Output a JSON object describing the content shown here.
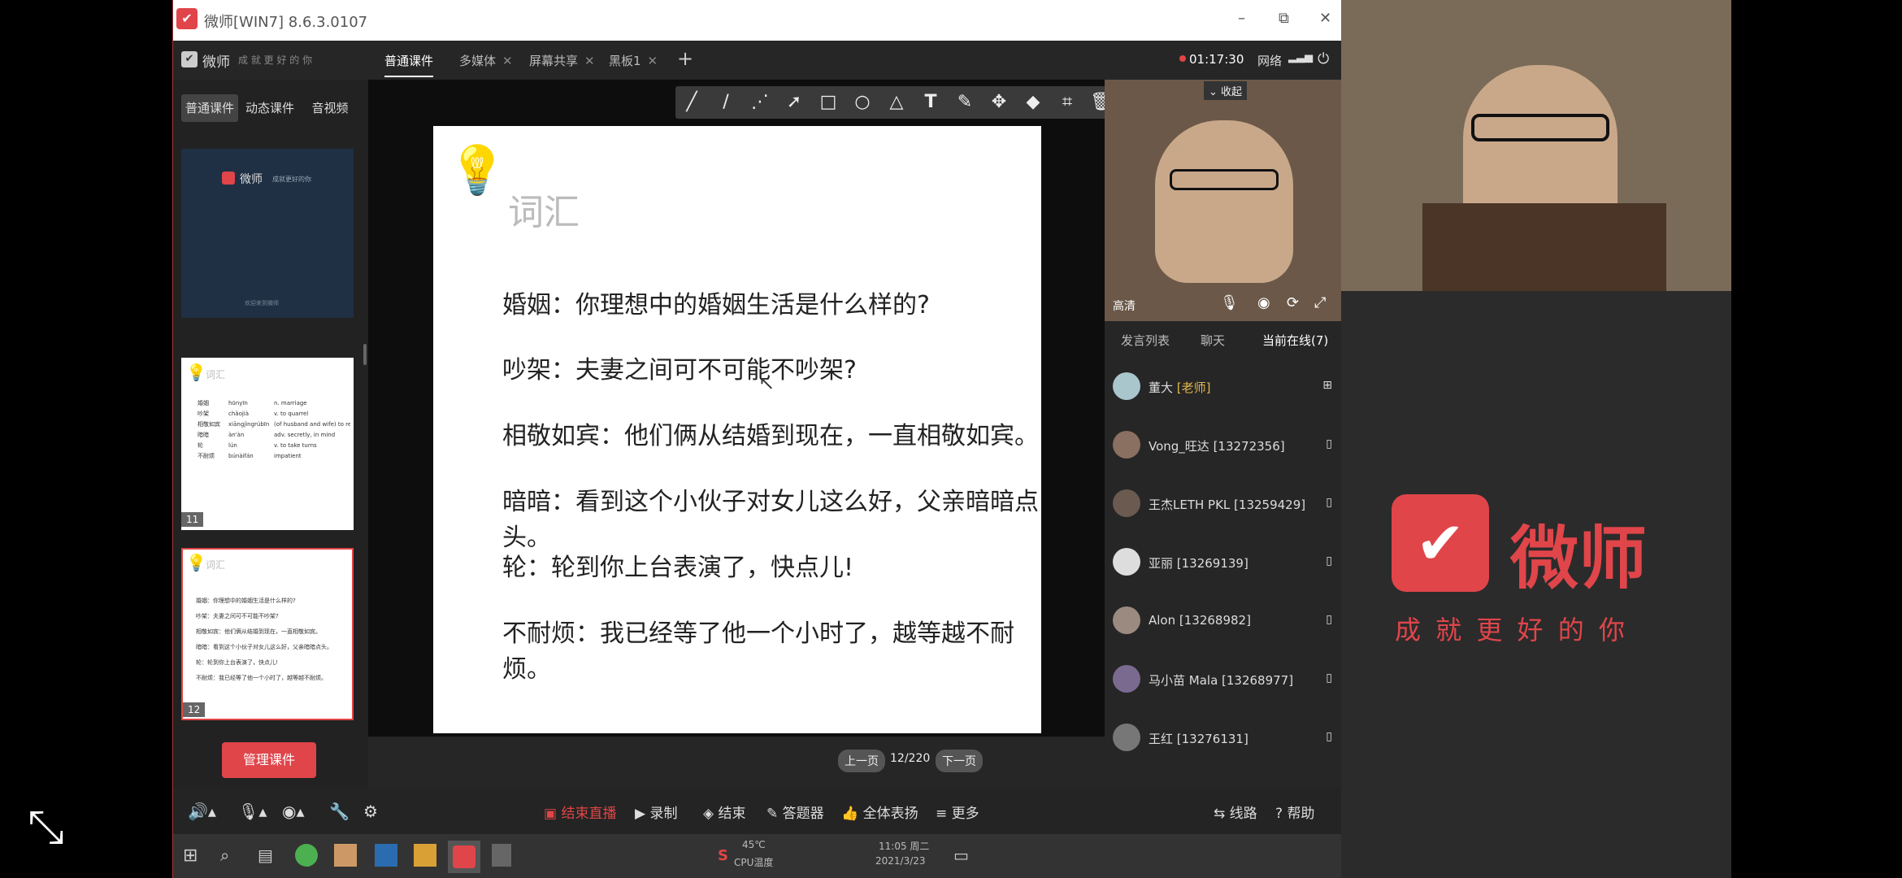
{
  "titlebar": {
    "title": "微师[WIN7] 8.6.3.0107",
    "minimize": "–",
    "maximize": "⧉",
    "close": "✕"
  },
  "topbar": {
    "logo": "微师",
    "slogan": "成 就 更 好 的 你",
    "tabs": [
      {
        "label": "普通课件"
      },
      {
        "label": "多媒体"
      },
      {
        "label": "屏幕共享"
      },
      {
        "label": "黑板1"
      }
    ],
    "add": "+",
    "rec_time": "01:17:30",
    "network": "网络",
    "power": "⏻"
  },
  "left_panel": {
    "tabs": [
      "普通课件",
      "动态课件",
      "音视频"
    ],
    "thumb1": {
      "logo": "微师",
      "subtitle": "成就更好的你",
      "footer": "欢迎来到微师"
    },
    "thumb11": {
      "title": "词汇",
      "rows": [
        [
          "婚姻",
          "hūnyīn",
          "n. marriage"
        ],
        [
          "吵架",
          "chǎojià",
          "v. to quarrel"
        ],
        [
          "相敬如宾",
          "xiāngjìngrúbīn",
          "(of husband and wife) to respect each other like guests"
        ],
        [
          "暗暗",
          "àn'àn",
          "adv. secretly, in mind"
        ],
        [
          "轮",
          "lún",
          "v. to take turns"
        ],
        [
          "不耐烦",
          "búnàifán",
          "impatient"
        ]
      ],
      "page": "11"
    },
    "thumb12": {
      "title": "词汇",
      "lines": [
        "婚姻：你理想中的婚姻生活是什么样的?",
        "吵架：夫妻之间可不可能不吵架?",
        "相敬如宾：他们俩从结婚到现在，一直相敬如宾。",
        "暗暗：看到这个小伙子对女儿这么好，父亲暗暗点头。",
        "轮：轮到你上台表演了，快点儿!",
        "不耐烦：我已经等了他一个小时了，越等越不耐烦。"
      ],
      "page": "12"
    },
    "manage_button": "管理课件"
  },
  "slide": {
    "title": "词汇",
    "lines": [
      "婚姻：你理想中的婚姻生活是什么样的?",
      "吵架：夫妻之间可不可能不吵架?",
      "相敬如宾：他们俩从结婚到现在，一直相敬如宾。",
      "暗暗：看到这个小伙子对女儿这么好，父亲暗暗点头。",
      "轮：轮到你上台表演了，快点儿!",
      "不耐烦：我已经等了他一个小时了，越等越不耐烦。"
    ]
  },
  "pager": {
    "prev": "上一页",
    "current": "12/220",
    "next": "下一页"
  },
  "camera": {
    "collapse": "收起",
    "name": "高清"
  },
  "right_panel": {
    "tabs": [
      "发言列表",
      "聊天",
      "当前在线(7)"
    ],
    "participants": [
      {
        "name": "董大",
        "tag": "[老师]",
        "device": "windows-icon"
      },
      {
        "name": "Vong_旺达 [13272356]",
        "device": "phone-icon"
      },
      {
        "name": "王杰LETH PKL [13259429]",
        "device": "phone-icon"
      },
      {
        "name": "亚丽 [13269139]",
        "device": "phone-icon"
      },
      {
        "name": "Alon [13268982]",
        "device": "phone-icon"
      },
      {
        "name": "马小苗 Mala [13268977]",
        "device": "phone-icon"
      },
      {
        "name": "王红 [13276131]",
        "device": "phone-icon"
      }
    ]
  },
  "bottombar": {
    "end_live": "结束直播",
    "record": "录制",
    "end": "结束",
    "answer": "答题器",
    "praise": "全体表扬",
    "more": "更多",
    "route": "线路",
    "help": "帮助"
  },
  "taskbar": {
    "temp": "45℃",
    "cpu": "CPU温度",
    "time": "11:05 周二",
    "date": "2021/3/23"
  },
  "brand": {
    "name": "微师",
    "slogan": "成 就 更 好 的 你"
  },
  "colors": {
    "brand_red": "#e0454a",
    "live_red": "#e04545",
    "bg_dark": "#2a2a2a"
  }
}
